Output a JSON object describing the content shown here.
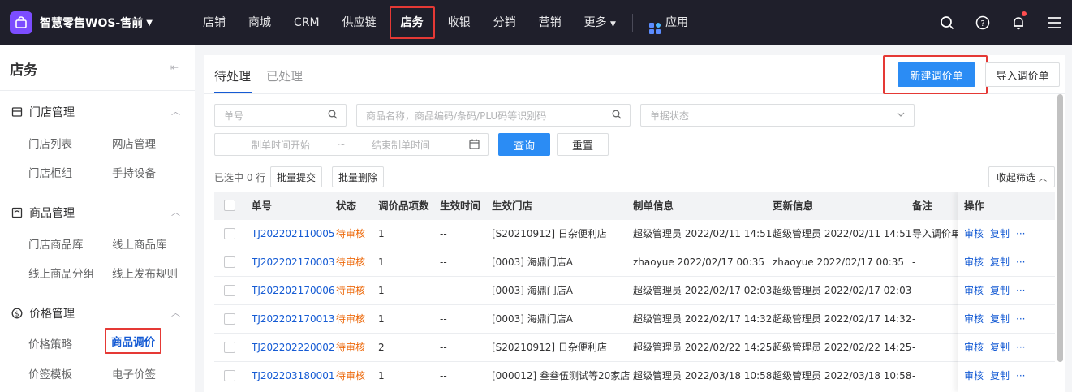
{
  "topbar": {
    "brand": "智慧零售WOS-售前",
    "nav": [
      "店铺",
      "商城",
      "CRM",
      "供应链",
      "店务",
      "收银",
      "分销",
      "营销",
      "更多"
    ],
    "apps": "应用"
  },
  "sidebar": {
    "title": "店务",
    "groups": [
      {
        "title": "门店管理",
        "items": [
          "门店列表",
          "网店管理",
          "门店柜组",
          "手持设备"
        ]
      },
      {
        "title": "商品管理",
        "items": [
          "门店商品库",
          "线上商品库",
          "线上商品分组",
          "线上发布规则"
        ]
      },
      {
        "title": "价格管理",
        "items": [
          "价格策略",
          "商品调价",
          "价签模板",
          "电子价签"
        ]
      }
    ]
  },
  "main": {
    "tabs": [
      "待处理",
      "已处理"
    ],
    "new_btn": "新建调价单",
    "import_btn": "导入调价单",
    "filters": {
      "order_no": "单号",
      "goods": "商品名称，商品编码/条码/PLU码等识别码",
      "status": "单据状态",
      "start_time": "制单时间开始",
      "range_sep": "~",
      "end_time": "结束制单时间",
      "query": "查询",
      "reset": "重置"
    },
    "selected": "已选中 0 行",
    "batch_submit": "批量提交",
    "batch_delete": "批量删除",
    "collapse_filter": "收起筛选",
    "columns": [
      "单号",
      "状态",
      "调价品项数",
      "生效时间",
      "生效门店",
      "制单信息",
      "更新信息",
      "备注",
      "操作"
    ],
    "rows": [
      {
        "no": "TJ202202110005",
        "status": "待审核",
        "count": "1",
        "effective": "--",
        "store": "[S20210912] 日杂便利店",
        "created": "超级管理员 2022/02/11 14:51",
        "updated": "超级管理员 2022/02/11 14:51",
        "remark": "导入调价单"
      },
      {
        "no": "TJ202202170003",
        "status": "待审核",
        "count": "1",
        "effective": "--",
        "store": "[0003] 海鼎门店A",
        "created": "zhaoyue 2022/02/17 00:35",
        "updated": "zhaoyue 2022/02/17 00:35",
        "remark": "-"
      },
      {
        "no": "TJ202202170006",
        "status": "待审核",
        "count": "1",
        "effective": "--",
        "store": "[0003] 海鼎门店A",
        "created": "超级管理员 2022/02/17 02:03",
        "updated": "超级管理员 2022/02/17 02:03",
        "remark": "-"
      },
      {
        "no": "TJ202202170013",
        "status": "待审核",
        "count": "1",
        "effective": "--",
        "store": "[0003] 海鼎门店A",
        "created": "超级管理员 2022/02/17 14:32",
        "updated": "超级管理员 2022/02/17 14:32",
        "remark": "-"
      },
      {
        "no": "TJ202202220002",
        "status": "待审核",
        "count": "2",
        "effective": "--",
        "store": "[S20210912] 日杂便利店",
        "created": "超级管理员 2022/02/22 14:25",
        "updated": "超级管理员 2022/02/22 14:25",
        "remark": "-"
      },
      {
        "no": "TJ202203180001",
        "status": "待审核",
        "count": "1",
        "effective": "--",
        "store": "[000012] 叁叁伍测试等20家店",
        "created": "超级管理员 2022/03/18 10:58",
        "updated": "超级管理员 2022/03/18 10:58",
        "remark": "-"
      }
    ],
    "ops": [
      "审核",
      "复制",
      "···"
    ]
  },
  "colors": {
    "accent": "#2b8cf4",
    "link": "#155bd4",
    "status_pending": "#ed6a0c",
    "highlight": "#e53935",
    "topbar": "#1f1f2b"
  }
}
